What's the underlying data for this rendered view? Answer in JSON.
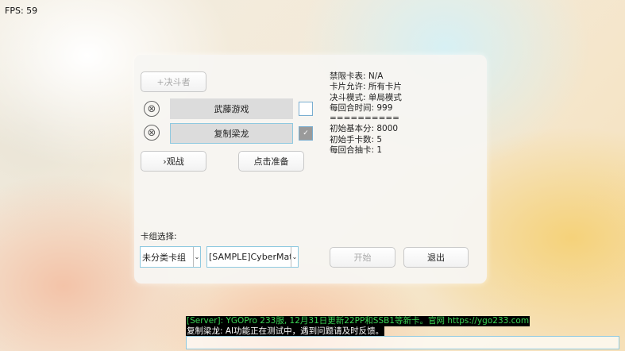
{
  "fps": "FPS: 59",
  "room": {
    "duelist_button": "+决斗者",
    "players": [
      {
        "name": "武藤游戏",
        "ready": false
      },
      {
        "name": "复制梁龙",
        "ready": true
      }
    ],
    "remove_icon": "⊗",
    "check_glyph": "✓",
    "watch_button": "›观战",
    "ready_button": "点击准备",
    "info": {
      "banlist": "禁限卡表: N/A",
      "card_allowed": "卡片允许: 所有卡片",
      "duel_mode": "决斗模式: 单局模式",
      "turn_time": "每回合时间: 999",
      "separator": "==========",
      "start_lp": "初始基本分: 8000",
      "start_hand": "初始手卡数: 5",
      "draw_count": "每回合抽卡: 1"
    },
    "deck_label": "卡组选择:",
    "deck_category": "未分类卡组",
    "deck_name": "[SAMPLE]CyberMata",
    "dropdown_glyph": "⌄",
    "start_button": "开始",
    "exit_button": "退出"
  },
  "chat": {
    "line1": "[Server]: YGOPro 233服, 12月31日更新22PP和SSB1等新卡。官网 https://ygo233.com",
    "line2": "复制梁龙: AI功能正在测试中，遇到问题请及时反馈。",
    "input_value": ""
  },
  "colors": {
    "server_text": "#39d353",
    "focus_border": "#8fc9e0"
  }
}
